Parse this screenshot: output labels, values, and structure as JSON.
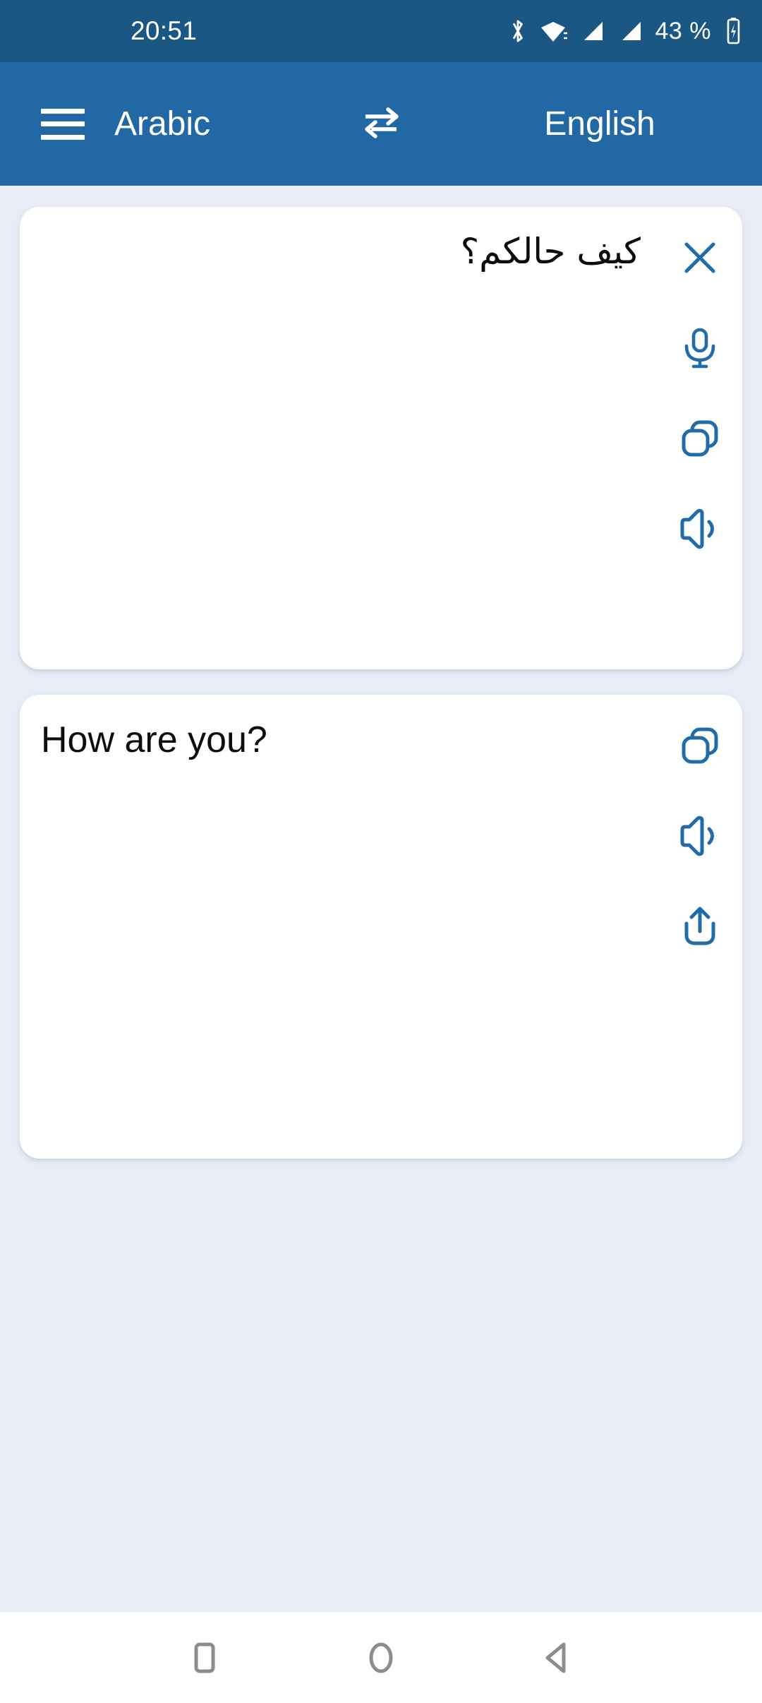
{
  "status_bar": {
    "time": "20:51",
    "battery_percent": "43 %",
    "icons": [
      "bluetooth-icon",
      "wifi-icon",
      "signal-sim1-icon",
      "signal-sim2-icon",
      "battery-charging-icon"
    ]
  },
  "app_bar": {
    "menu_icon": "hamburger-menu-icon",
    "source_language": "Arabic",
    "swap_icon": "swap-languages-icon",
    "target_language": "English",
    "background_color": "#2168A4"
  },
  "source_card": {
    "text": "كيف حالكم؟",
    "actions": [
      {
        "name": "clear-text-button",
        "icon": "close-icon"
      },
      {
        "name": "voice-input-button",
        "icon": "microphone-icon"
      },
      {
        "name": "copy-source-button",
        "icon": "copy-icon"
      },
      {
        "name": "speak-source-button",
        "icon": "speaker-icon"
      }
    ]
  },
  "target_card": {
    "text": "How are you?",
    "actions": [
      {
        "name": "copy-translation-button",
        "icon": "copy-icon"
      },
      {
        "name": "speak-translation-button",
        "icon": "speaker-icon"
      },
      {
        "name": "share-translation-button",
        "icon": "share-icon"
      }
    ]
  },
  "nav_bar": {
    "buttons": [
      {
        "name": "recents-button",
        "icon": "square-icon"
      },
      {
        "name": "home-button",
        "icon": "circle-icon"
      },
      {
        "name": "back-button",
        "icon": "triangle-back-icon"
      }
    ]
  },
  "colors": {
    "status_bar": "#1A5782",
    "app_bar": "#2168A4",
    "page_background": "#E8EDF5",
    "card_background": "#FFFFFF",
    "accent_icon": "#216CA8",
    "text_primary": "#0D0D0D",
    "nav_icon": "#8C8C8C"
  }
}
